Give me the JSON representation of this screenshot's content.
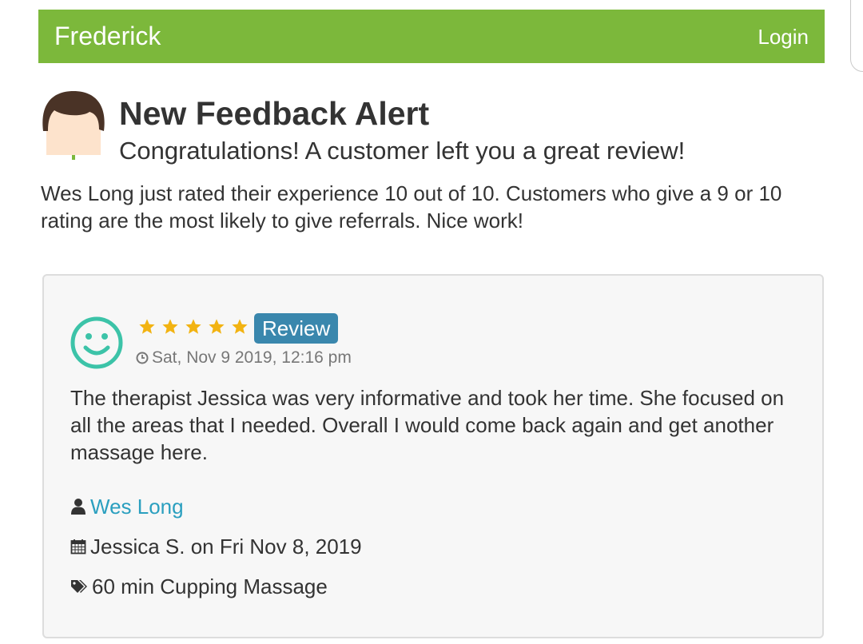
{
  "header": {
    "brand": "Frederick",
    "login_label": "Login",
    "bar_color": "#7cb83b"
  },
  "alert": {
    "title": "New Feedback Alert",
    "subtitle": "Congratulations! A customer left you a great review!",
    "message": "Wes Long just rated their experience 10 out of 10. Customers who give a 9 or 10 rating are the most likely to give referrals. Nice work!"
  },
  "review": {
    "rating_stars": 5,
    "badge_label": "Review",
    "badge_color": "#3a87ad",
    "timestamp": "Sat, Nov 9 2019, 12:16 pm",
    "text": "The therapist Jessica was very informative and took her time. She focused on all the areas that I needed. Overall I would come back again and get another massage here.",
    "reviewer_name": "Wes Long",
    "appointment": "Jessica S. on Fri Nov 8, 2019",
    "service": "60 min Cupping Massage"
  },
  "icons": {
    "avatar": "person-avatar-icon",
    "sentiment": "smiley-face-icon",
    "time": "clock-icon",
    "user": "user-icon",
    "calendar": "calendar-icon",
    "tag": "tag-icon"
  }
}
